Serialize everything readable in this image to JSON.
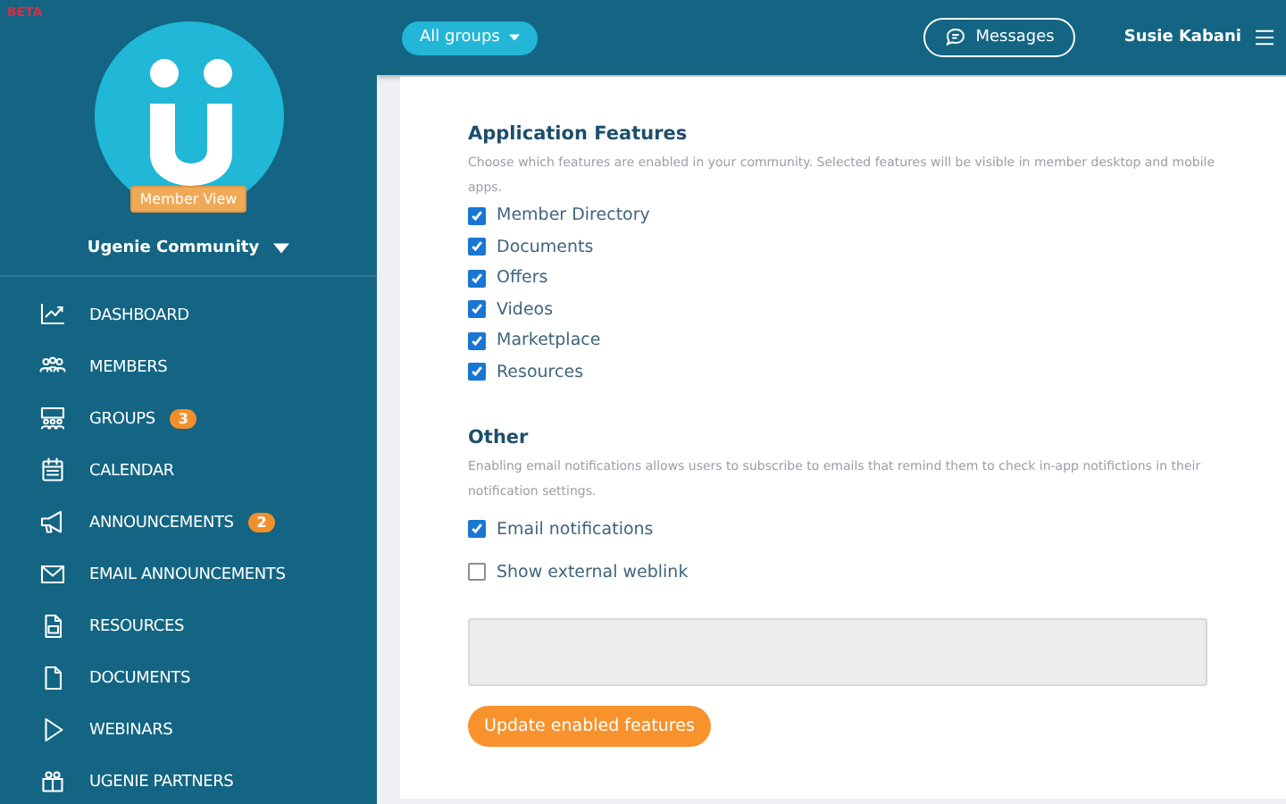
{
  "beta_label": "BETA",
  "logo": {
    "badge": "Member View"
  },
  "community": {
    "name": "Ugenie Community"
  },
  "nav": [
    {
      "label": "DASHBOARD"
    },
    {
      "label": "MEMBERS"
    },
    {
      "label": "GROUPS",
      "badge": "3"
    },
    {
      "label": "CALENDAR"
    },
    {
      "label": "ANNOUNCEMENTS",
      "badge": "2"
    },
    {
      "label": "EMAIL ANNOUNCEMENTS"
    },
    {
      "label": "RESOURCES"
    },
    {
      "label": "DOCUMENTS"
    },
    {
      "label": "WEBINARS"
    },
    {
      "label": "UGENIE PARTNERS"
    }
  ],
  "topbar": {
    "group_filter": "All groups",
    "messages": "Messages",
    "user": "Susie Kabani"
  },
  "sections": [
    {
      "title": "Application Features",
      "description": "Choose which features are enabled in your community. Selected features will be visible in member desktop and mobile apps.",
      "options": [
        {
          "label": "Member Directory",
          "checked": true
        },
        {
          "label": "Documents",
          "checked": true
        },
        {
          "label": "Offers",
          "checked": true
        },
        {
          "label": "Videos",
          "checked": true
        },
        {
          "label": "Marketplace",
          "checked": true
        },
        {
          "label": "Resources",
          "checked": true
        }
      ]
    },
    {
      "title": "Other",
      "description": "Enabling email notifications allows users to subscribe to emails that remind them to check in-app notifictions in their notification settings.",
      "options": [
        {
          "label": "Email notifications",
          "checked": true
        },
        {
          "label": "Show external weblink",
          "checked": false
        }
      ]
    }
  ],
  "weblink_field": {
    "disabled": true
  },
  "submit": "Update enabled features"
}
